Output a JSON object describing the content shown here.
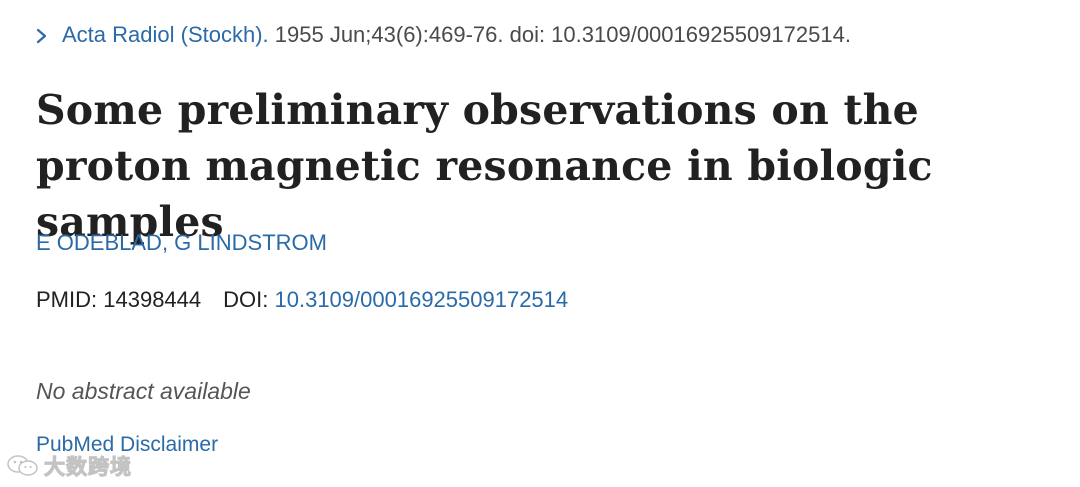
{
  "citation": {
    "chevron_icon": "chevron-right-icon",
    "journal": "Acta Radiol (Stockh).",
    "details": "1955 Jun;43(6):469-76. doi: 10.3109/00016925509172514."
  },
  "article": {
    "title": "Some preliminary observations on the proton magnetic resonance in biologic samples"
  },
  "authors": [
    {
      "name": "E ODEBLAD"
    },
    {
      "name": "G LINDSTROM"
    }
  ],
  "author_separator": ", ",
  "identifiers": {
    "pmid_label": "PMID:",
    "pmid_value": "14398444",
    "doi_label": "DOI:",
    "doi_value": "10.3109/00016925509172514"
  },
  "abstract": {
    "status": "No abstract available"
  },
  "disclaimer": {
    "label": "PubMed Disclaimer"
  },
  "watermark": {
    "icon": "wechat-logo-icon",
    "text": "大数跨境"
  },
  "colors": {
    "link": "#2b6aa8",
    "text": "#212121",
    "muted": "#555555"
  }
}
